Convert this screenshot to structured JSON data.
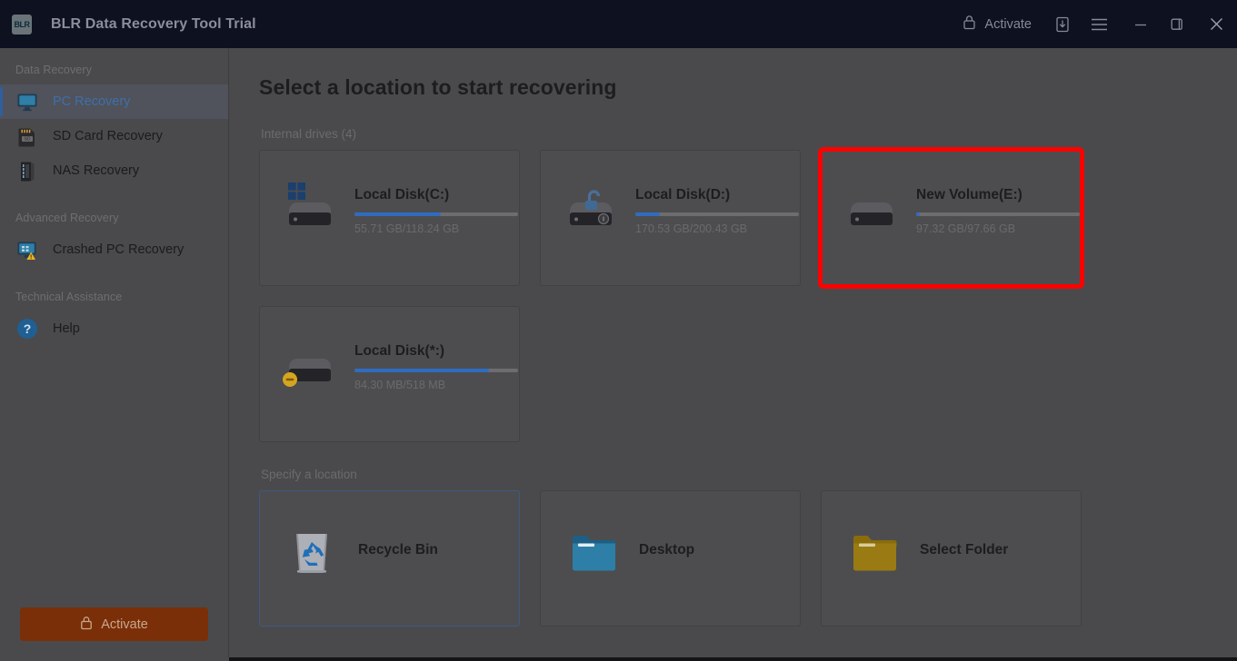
{
  "window": {
    "logo_text": "BLR",
    "title": "BLR Data Recovery Tool Trial",
    "activate_label": "Activate",
    "icons": {
      "lock": "lock-icon",
      "download": "download-install-icon",
      "menu": "hamburger-menu-icon",
      "minimize": "minimize-icon",
      "maximize": "maximize-restore-icon",
      "close": "close-icon"
    }
  },
  "sidebar": {
    "groups": [
      {
        "label": "Data Recovery",
        "items": [
          {
            "label": "PC Recovery",
            "icon": "monitor-icon",
            "active": true
          },
          {
            "label": "SD Card Recovery",
            "icon": "sd-card-icon",
            "active": false
          },
          {
            "label": "NAS Recovery",
            "icon": "nas-server-icon",
            "active": false
          }
        ]
      },
      {
        "label": "Advanced Recovery",
        "items": [
          {
            "label": "Crashed PC Recovery",
            "icon": "crashed-pc-icon",
            "active": false
          }
        ]
      },
      {
        "label": "Technical Assistance",
        "items": [
          {
            "label": "Help",
            "icon": "help-question-icon",
            "active": false
          }
        ]
      }
    ],
    "activate_button": "Activate"
  },
  "main": {
    "page_title": "Select a location to start recovering",
    "refresh_icon": "refresh-icon",
    "internal_drives_label": "Internal drives (4)",
    "specify_location_label": "Specify a location",
    "drives": [
      {
        "name": "Local Disk(C:)",
        "size": "55.71 GB/118.24 GB",
        "used_percent": 53,
        "badge": "windows-logo",
        "highlighted": false
      },
      {
        "name": "Local Disk(D:)",
        "size": "170.53 GB/200.43 GB",
        "used_percent": 15,
        "badge": "bitlocker-unlocked",
        "highlighted": false
      },
      {
        "name": "New Volume(E:)",
        "size": "97.32 GB/97.66 GB",
        "used_percent": 2,
        "badge": "none",
        "highlighted": true
      },
      {
        "name": "Local Disk(*:)",
        "size": "84.30 MB/518 MB",
        "used_percent": 82,
        "badge": "warning",
        "highlighted": false
      }
    ],
    "locations": [
      {
        "label": "Recycle Bin",
        "icon": "recycle-bin-icon",
        "selected": true
      },
      {
        "label": "Desktop",
        "icon": "blue-folder-icon",
        "selected": false
      },
      {
        "label": "Select Folder",
        "icon": "yellow-folder-icon",
        "selected": false
      }
    ]
  },
  "colors": {
    "titlebar_bg": "#0e1120",
    "app_bg": "#4a4a4c",
    "card_bg": "#4d4d4f",
    "accent_blue": "#2f6cc0",
    "highlight_red": "#ff0000",
    "activate_orange": "#7a2f08",
    "selection_blue": "#3c5a82"
  }
}
